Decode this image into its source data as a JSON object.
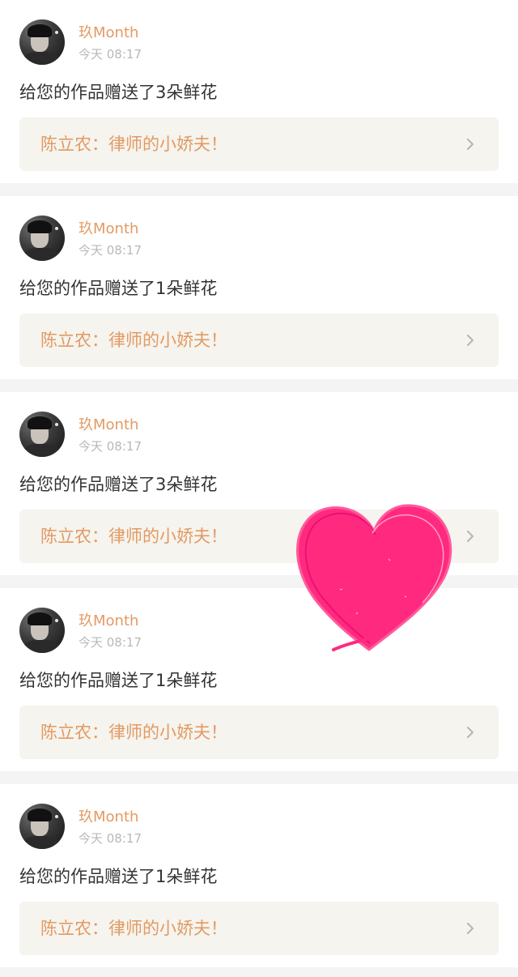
{
  "icons": {
    "avatar": "user-avatar-photo",
    "chevron": "chevron-right-icon",
    "sticker": "heart-doodle-sticker"
  },
  "colors": {
    "accent": "#e39a63",
    "heart": "#ff2a7f"
  },
  "notifications": [
    {
      "username": "玖Month",
      "time": "今天 08:17",
      "message": "给您的作品赠送了3朵鲜花",
      "work_title": "陈立农：律师的小娇夫！"
    },
    {
      "username": "玖Month",
      "time": "今天 08:17",
      "message": "给您的作品赠送了1朵鲜花",
      "work_title": "陈立农：律师的小娇夫！"
    },
    {
      "username": "玖Month",
      "time": "今天 08:17",
      "message": "给您的作品赠送了3朵鲜花",
      "work_title": "陈立农：律师的小娇夫！"
    },
    {
      "username": "玖Month",
      "time": "今天 08:17",
      "message": "给您的作品赠送了1朵鲜花",
      "work_title": "陈立农：律师的小娇夫！"
    },
    {
      "username": "玖Month",
      "time": "今天 08:17",
      "message": "给您的作品赠送了1朵鲜花",
      "work_title": "陈立农：律师的小娇夫！"
    }
  ]
}
